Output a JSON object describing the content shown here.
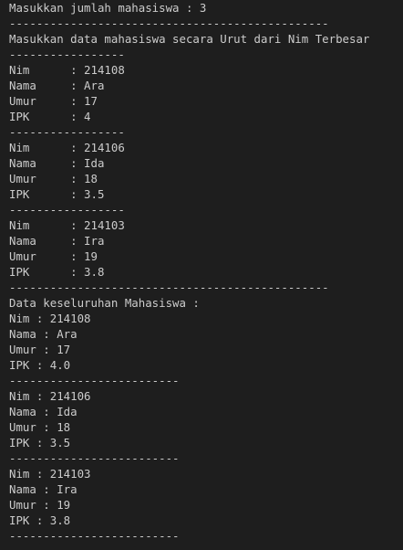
{
  "terminal": {
    "lines": [
      "Masukkan jumlah mahasiswa : 3",
      "-----------------------------------------------",
      "Masukkan data mahasiswa secara Urut dari Nim Terbesar",
      "-----------------",
      "Nim      : 214108",
      "Nama     : Ara",
      "Umur     : 17",
      "IPK      : 4",
      "-----------------",
      "Nim      : 214106",
      "Nama     : Ida",
      "Umur     : 18",
      "IPK      : 3.5",
      "-----------------",
      "Nim      : 214103",
      "Nama     : Ira",
      "Umur     : 19",
      "IPK      : 3.8",
      "-----------------------------------------------",
      "Data keseluruhan Mahasiswa :",
      "Nim : 214108",
      "Nama : Ara",
      "Umur : 17",
      "IPK : 4.0",
      "-------------------------",
      "Nim : 214106",
      "Nama : Ida",
      "Umur : 18",
      "IPK : 3.5",
      "-------------------------",
      "Nim : 214103",
      "Nama : Ira",
      "Umur : 19",
      "IPK : 3.8",
      "-------------------------"
    ]
  }
}
